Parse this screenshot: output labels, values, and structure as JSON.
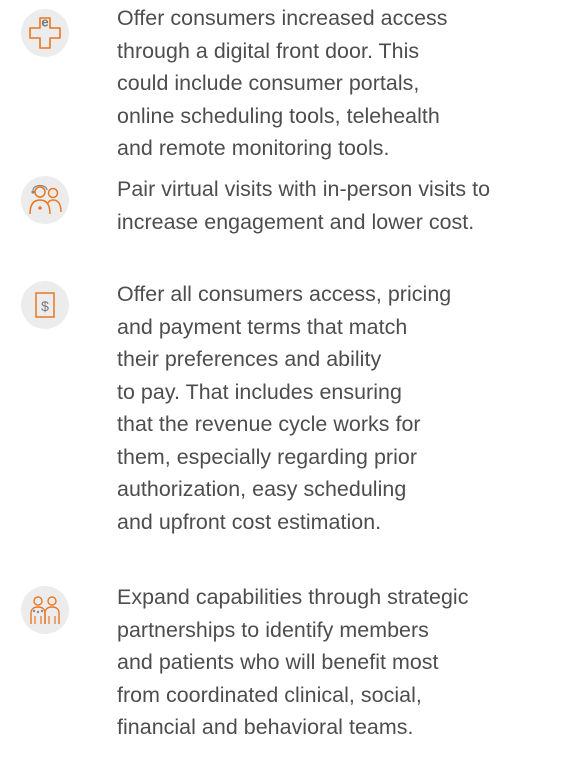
{
  "accent_color": "#e87722",
  "icon_background": "#ececec",
  "text_color": "#4d4d4d",
  "items": [
    {
      "icon": "e-health-cross-icon",
      "icon_letter": "e",
      "text": "Offer consumers increased access\nthrough a digital front door. This\ncould include consumer portals,\nonline scheduling tools, telehealth\nand remote monitoring tools."
    },
    {
      "icon": "virtual-visit-people-icon",
      "text": "Pair virtual visits with in-person visits to\nincrease engagement and lower cost."
    },
    {
      "icon": "dollar-bill-icon",
      "icon_symbol": "$",
      "text": "Offer all consumers access, pricing\nand payment terms that match\ntheir preferences and ability\nto pay. That includes ensuring\nthat the revenue cycle works for\nthem, especially regarding prior\nauthorization, easy scheduling\nand upfront cost estimation."
    },
    {
      "icon": "partnership-team-icon",
      "text": "Expand capabilities through strategic\npartnerships to identify members\nand patients who will benefit most\nfrom coordinated clinical, social,\nfinancial and behavioral teams."
    }
  ]
}
